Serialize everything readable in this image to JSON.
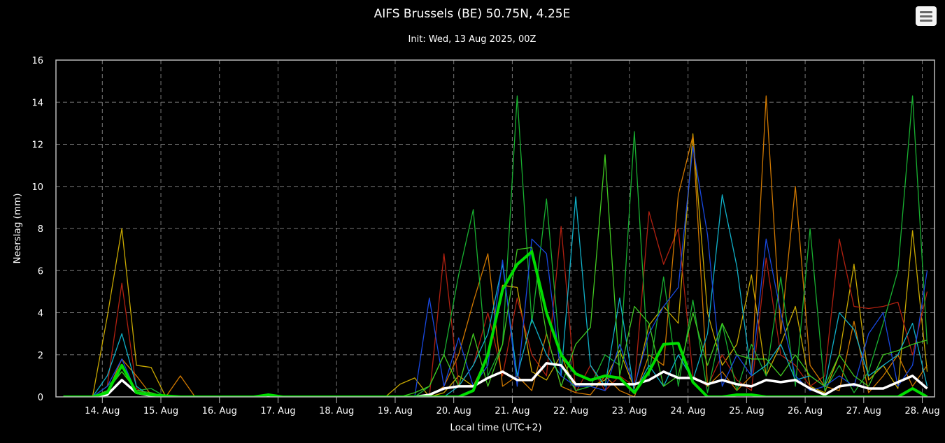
{
  "chart_data": {
    "type": "line",
    "title": "AIFS Brussels (BE) 50.75N, 4.25E",
    "subtitle": "Init: Wed, 13 Aug 2025, 00Z",
    "xlabel": "Local time (UTC+2)",
    "ylabel": "Neerslag (mm)",
    "ylim": [
      0,
      16
    ],
    "yticks": [
      0,
      2,
      4,
      6,
      8,
      10,
      12,
      14,
      16
    ],
    "xlim_hours_from_14aug": [
      -19,
      341
    ],
    "xticks": [
      "14. Aug",
      "15. Aug",
      "16. Aug",
      "17. Aug",
      "18. Aug",
      "19. Aug",
      "20. Aug",
      "21. Aug",
      "22. Aug",
      "23. Aug",
      "24. Aug",
      "25. Aug",
      "26. Aug",
      "27. Aug",
      "28. Aug"
    ],
    "grid": true,
    "x_start_hour_from_14aug": -16,
    "x_step_hours": 6,
    "series": [
      {
        "name": "member-gold",
        "color": "#c8a800",
        "role": "member",
        "values": [
          0,
          0,
          0,
          3.8,
          8.0,
          1.5,
          1.4,
          0,
          0,
          0,
          0,
          0,
          0,
          0,
          0,
          0,
          0,
          0,
          0,
          0,
          0,
          0,
          0,
          0.6,
          0.9,
          0,
          0.2,
          1.0,
          0.5,
          2.0,
          5.3,
          5.2,
          1.2,
          0.8,
          2.0,
          0.3,
          0.5,
          0.8,
          2.2,
          0.4,
          3.4,
          4.3,
          3.5,
          12.5,
          4.0,
          1.5,
          2.5,
          5.8,
          1.0,
          2.5,
          4.3,
          0.5,
          0.2,
          2.0,
          6.3,
          0.8,
          1.5,
          0.4,
          7.9,
          1.2
        ]
      },
      {
        "name": "member-red",
        "color": "#b02010",
        "role": "member",
        "values": [
          0,
          0,
          0,
          0.5,
          5.4,
          0.4,
          0,
          0,
          0,
          0,
          0,
          0,
          0,
          0,
          0,
          0,
          0,
          0,
          0,
          0,
          0,
          0,
          0,
          0,
          0,
          0,
          6.8,
          0.5,
          1.5,
          4.0,
          1.0,
          4.7,
          2.0,
          1.0,
          8.1,
          0.2,
          1.5,
          0.3,
          1.0,
          0.5,
          8.8,
          6.3,
          8.0,
          1.0,
          0.5,
          2.0,
          0.8,
          0.3,
          6.6,
          2.0,
          1.5,
          0.5,
          1.0,
          7.5,
          4.3,
          4.2,
          4.3,
          4.5,
          2.0,
          5.0
        ]
      },
      {
        "name": "member-orange",
        "color": "#d07800",
        "role": "member",
        "values": [
          0,
          0,
          0,
          0.2,
          1.8,
          1.0,
          0.1,
          0,
          1.0,
          0,
          0,
          0,
          0,
          0,
          0,
          0,
          0,
          0,
          0,
          0,
          0,
          0,
          0,
          0,
          0,
          0,
          0.5,
          2.0,
          4.5,
          6.8,
          0.5,
          1.0,
          0.3,
          3.0,
          0.5,
          0.2,
          0.1,
          1.0,
          0.3,
          0,
          2.0,
          1.5,
          9.6,
          12.4,
          0.5,
          1.2,
          0.3,
          1.0,
          14.3,
          3.0,
          10.0,
          1.5,
          0.5,
          0.3,
          3.6,
          0.2,
          1.0,
          2.0,
          0.5,
          1.5
        ]
      },
      {
        "name": "member-green",
        "color": "#18b030",
        "role": "member",
        "values": [
          0,
          0,
          0,
          0.5,
          1.2,
          0.3,
          0.4,
          0,
          0,
          0,
          0,
          0,
          0,
          0,
          0,
          0,
          0,
          0,
          0,
          0,
          0,
          0,
          0,
          0,
          0,
          0.5,
          2.0,
          5.8,
          8.9,
          1.0,
          2.5,
          14.3,
          3.5,
          9.4,
          1.5,
          0.3,
          0.5,
          2.0,
          1.5,
          12.6,
          1.0,
          5.7,
          0.5,
          4.6,
          0.2,
          3.5,
          0.3,
          2.5,
          1.0,
          5.7,
          0.5,
          8.0,
          0.3,
          1.5,
          0.2,
          1.2,
          3.5,
          6.0,
          14.3,
          2.5
        ]
      },
      {
        "name": "member-cyan",
        "color": "#10b0c8",
        "role": "member",
        "values": [
          0,
          0,
          0,
          1.0,
          3.0,
          0.5,
          0,
          0,
          0,
          0,
          0,
          0,
          0,
          0,
          0,
          0,
          0,
          0,
          0,
          0,
          0,
          0,
          0,
          0,
          0,
          0,
          0,
          0.5,
          1.5,
          3.0,
          6.3,
          1.0,
          3.7,
          2.0,
          1.0,
          9.5,
          1.5,
          0.5,
          4.7,
          0.2,
          1.5,
          0.5,
          2.0,
          0.8,
          3.0,
          9.6,
          6.2,
          1.0,
          1.5,
          2.5,
          0.8,
          1.0,
          0.5,
          4.0,
          3.2,
          1.0,
          1.5,
          2.0,
          3.5,
          0.5
        ]
      },
      {
        "name": "member-blue",
        "color": "#1848e0",
        "role": "member",
        "values": [
          0,
          0,
          0,
          0.5,
          1.8,
          0.2,
          0,
          0,
          0,
          0,
          0,
          0,
          0,
          0,
          0,
          0,
          0,
          0,
          0,
          0,
          0,
          0,
          0,
          0,
          0,
          4.7,
          0.5,
          2.8,
          0.5,
          1.5,
          6.5,
          0.5,
          7.5,
          6.8,
          1.0,
          0.5,
          0.5,
          0.3,
          2.5,
          0.5,
          3.0,
          4.3,
          5.2,
          11.9,
          7.7,
          0.5,
          2.0,
          1.0,
          7.5,
          4.0,
          1.0,
          0.3,
          0.5,
          1.0,
          0.5,
          3.0,
          4.0,
          0.5,
          1.5,
          6.0
        ]
      },
      {
        "name": "member-lime",
        "color": "#40c820",
        "role": "member",
        "values": [
          0,
          0,
          0,
          0.3,
          1.2,
          0.3,
          0.2,
          0,
          0,
          0,
          0,
          0,
          0,
          0,
          0,
          0,
          0,
          0,
          0,
          0,
          0,
          0,
          0,
          0,
          0.2,
          0.5,
          2.0,
          0.5,
          3.0,
          0.5,
          2.5,
          7.0,
          7.1,
          3.0,
          0.5,
          2.5,
          3.3,
          11.5,
          1.0,
          4.3,
          3.5,
          0.5,
          1.0,
          4.0,
          1.5,
          3.5,
          2.0,
          1.8,
          1.8,
          1.0,
          2.0,
          1.0,
          0.5,
          2.0,
          1.0,
          0.5,
          2.0,
          2.2,
          2.5,
          2.7
        ]
      },
      {
        "name": "ensemble-mean",
        "color": "#ffffff",
        "role": "mean",
        "values": [
          0,
          0,
          0,
          0.1,
          0.8,
          0.2,
          0.05,
          0,
          0,
          0,
          0,
          0,
          0,
          0,
          0,
          0,
          0,
          0,
          0,
          0,
          0,
          0,
          0,
          0,
          0,
          0.1,
          0.4,
          0.5,
          0.5,
          0.9,
          1.2,
          0.8,
          0.8,
          1.6,
          1.5,
          0.6,
          0.6,
          0.6,
          0.6,
          0.6,
          0.8,
          1.2,
          0.9,
          0.9,
          0.6,
          0.8,
          0.6,
          0.5,
          0.8,
          0.7,
          0.8,
          0.4,
          0.1,
          0.5,
          0.6,
          0.4,
          0.4,
          0.7,
          1.0,
          0.4
        ]
      },
      {
        "name": "control-run",
        "color": "#00dd00",
        "role": "control",
        "values": [
          0,
          0,
          0,
          0.2,
          1.5,
          0.2,
          0.1,
          0.05,
          0,
          0,
          0,
          0,
          0,
          0,
          0.1,
          0,
          0,
          0,
          0,
          0,
          0,
          0,
          0,
          0,
          0,
          0,
          0,
          0,
          0.3,
          2.0,
          5.1,
          6.3,
          6.9,
          4.0,
          2.0,
          1.1,
          0.8,
          1.0,
          0.9,
          0.2,
          1.2,
          2.5,
          2.55,
          0.7,
          0,
          0,
          0.1,
          0.1,
          0,
          0,
          0,
          0,
          0,
          0,
          0,
          0,
          0,
          0,
          0.4,
          0
        ]
      }
    ]
  },
  "menu": {
    "icon": "hamburger-icon"
  }
}
